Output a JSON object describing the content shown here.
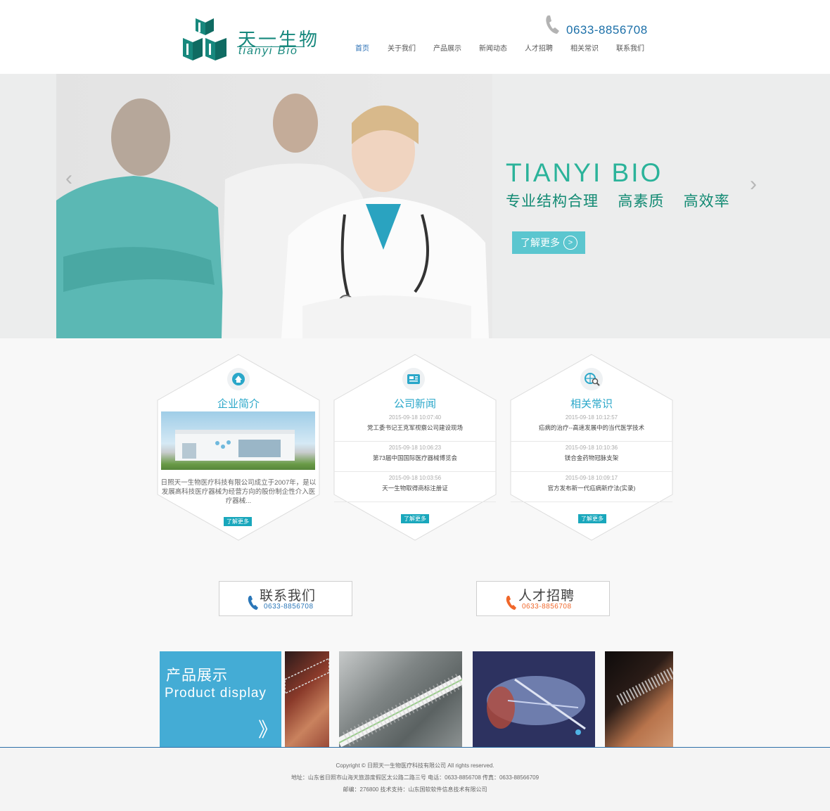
{
  "logo": {
    "cn": "天一生物",
    "en": "tianyi  Bio"
  },
  "header": {
    "phone": "0633-8856708"
  },
  "nav": [
    {
      "label": "首页",
      "active": true
    },
    {
      "label": "关于我们"
    },
    {
      "label": "产品展示"
    },
    {
      "label": "新闻动态"
    },
    {
      "label": "人才招聘"
    },
    {
      "label": "相关常识"
    },
    {
      "label": "联系我们"
    }
  ],
  "banner": {
    "title": "TIANYI   BIO",
    "subtitle": "专业结构合理    高素质    高效率",
    "button": "了解更多",
    "prev_icon": "chevron-left-icon",
    "next_icon": "chevron-right-icon"
  },
  "cards": {
    "intro": {
      "title": "企业简介",
      "text": "日照天一生物医疗科技有限公司成立于2007年，是以发展高科技医疗器械为经营方向的股份制企性介入医疗器械...",
      "more": "了解更多",
      "icon": "home-icon"
    },
    "news": {
      "title": "公司新闻",
      "more": "了解更多",
      "icon": "newspaper-icon",
      "items": [
        {
          "date": "2015-09-18 10:07:40",
          "title": "党工委书记王克军视察公司建设现场"
        },
        {
          "date": "2015-09-18 10:06:23",
          "title": "第73届中国国际医疗器械博览会"
        },
        {
          "date": "2015-09-18 10:03:56",
          "title": "天一生物取得商标注册证"
        }
      ]
    },
    "knowledge": {
      "title": "相关常识",
      "more": "了解更多",
      "icon": "globe-search-icon",
      "items": [
        {
          "date": "2015-09-18 10:12:57",
          "title": "疝病的治疗--高速发展中的当代医学技术"
        },
        {
          "date": "2015-09-18 10:10:36",
          "title": "镁合金药物冠脉支架"
        },
        {
          "date": "2015-09-18 10:09:17",
          "title": "官方发布新一代疝病新疗法(实录)"
        }
      ]
    }
  },
  "contact": {
    "title": "联系我们",
    "phone": "0633-8856708",
    "color": "#2a76b8"
  },
  "recruit": {
    "title": "人才招聘",
    "phone": "0633-8856708",
    "color": "#f0672a"
  },
  "products": {
    "cn": "产品展示",
    "en": "Product display",
    "arrow": "》"
  },
  "footer": {
    "copyright": "Copyright © 日照天一生物医疗科技有限公司 All rights reserved.",
    "address": "地址：山东省日照市山海天旅游度假区太公路二路三号  电话：0633-8856708  传真：0633-88566709",
    "postal": "邮编：276800  技术支持：山东国软软件信息技术有限公司"
  },
  "colors": {
    "brand": "#17887d",
    "banner_accent": "#2bb39a",
    "card_title": "#2aa7c9",
    "product_box": "#44acd5"
  }
}
